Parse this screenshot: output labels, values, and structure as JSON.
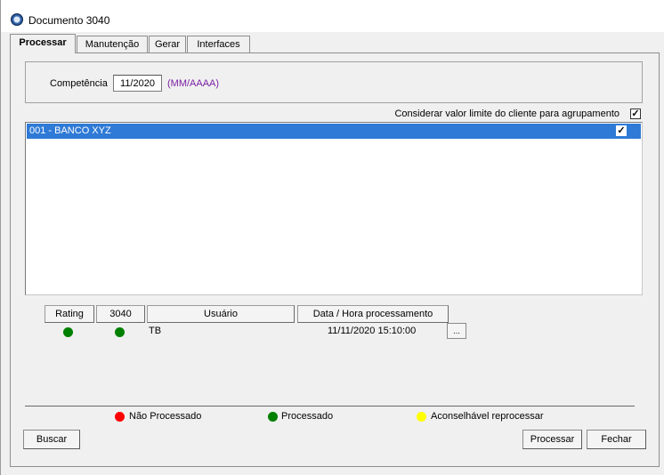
{
  "window": {
    "title": "Documento 3040"
  },
  "tabs": [
    {
      "label": "Processar"
    },
    {
      "label": "Manutenção"
    },
    {
      "label": "Gerar"
    },
    {
      "label": "Interfaces"
    }
  ],
  "competencia": {
    "label": "Competência",
    "value": "11/2020",
    "hint": "(MM/AAAA)"
  },
  "considerar": {
    "label": "Considerar valor limite do cliente para agrupamento",
    "checked": true
  },
  "bank_list": {
    "items": [
      {
        "label": "001 - BANCO XYZ",
        "checked": true,
        "selected": true
      }
    ]
  },
  "status_table": {
    "headers": [
      "Rating",
      "3040",
      "Usuário",
      "Data / Hora processamento"
    ],
    "row": {
      "rating_status": "green",
      "status_3040": "green",
      "usuario": "TB",
      "data_hora": "11/11/2020 15:10:00"
    },
    "details_button": "..."
  },
  "legend": [
    {
      "label": "Não Processado",
      "color": "#ff0000"
    },
    {
      "label": "Processado",
      "color": "#008000"
    },
    {
      "label": "Aconselhável reprocessar",
      "color": "#ffff00"
    }
  ],
  "buttons": {
    "buscar": "Buscar",
    "processar": "Processar",
    "fechar": "Fechar"
  },
  "colors": {
    "selection": "#2f7ad6",
    "hint": "#7a1fa2",
    "status_green": "#008000"
  }
}
